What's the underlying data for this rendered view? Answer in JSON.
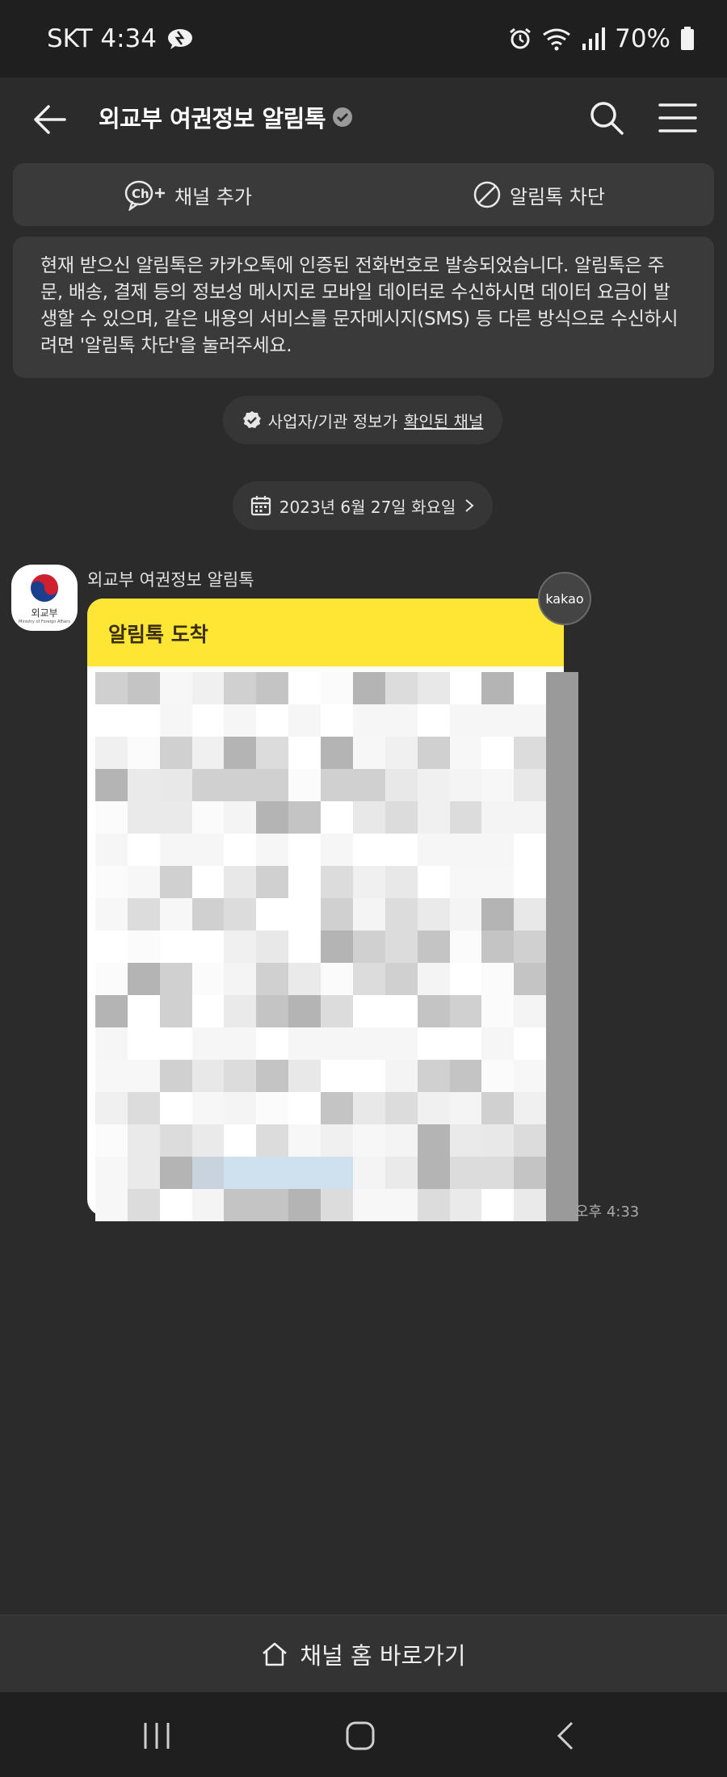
{
  "status_bar": {
    "carrier_time": "SKT 4:34",
    "battery": "70%"
  },
  "header": {
    "title": "외교부 여권정보 알림톡"
  },
  "actions": {
    "add_channel": "채널 추가",
    "block": "알림톡 차단"
  },
  "notice": {
    "text": "현재 받으신 알림톡은 카카오톡에 인증된 전화번호로 발송되었습니다. 알림톡은 주문, 배송, 결제 등의 정보성 메시지로 모바일 데이터로 수신하시면 데이터 요금이 발생할 수 있으며, 같은 내용의 서비스를 문자메시지(SMS) 등 다른 방식으로 수신하시려면 '알림톡 차단'을 눌러주세요."
  },
  "verified": {
    "prefix": "사업자/기관 정보가",
    "link": "확인된 채널"
  },
  "date_divider": {
    "label": "2023년 6월 27일 화요일"
  },
  "message": {
    "sender": "외교부 여권정보 알림톡",
    "avatar_org": "외교부",
    "avatar_org_en": "Ministry of Foreign Affairs",
    "header": "알림톡 도착",
    "badge": "kakao",
    "time": "오후 4:33"
  },
  "bottom": {
    "channel_home": "채널 홈 바로가기"
  },
  "colors": {
    "bubble_header": "#ffe635",
    "background": "#2b2b2b",
    "panel": "#3a3a3a"
  }
}
